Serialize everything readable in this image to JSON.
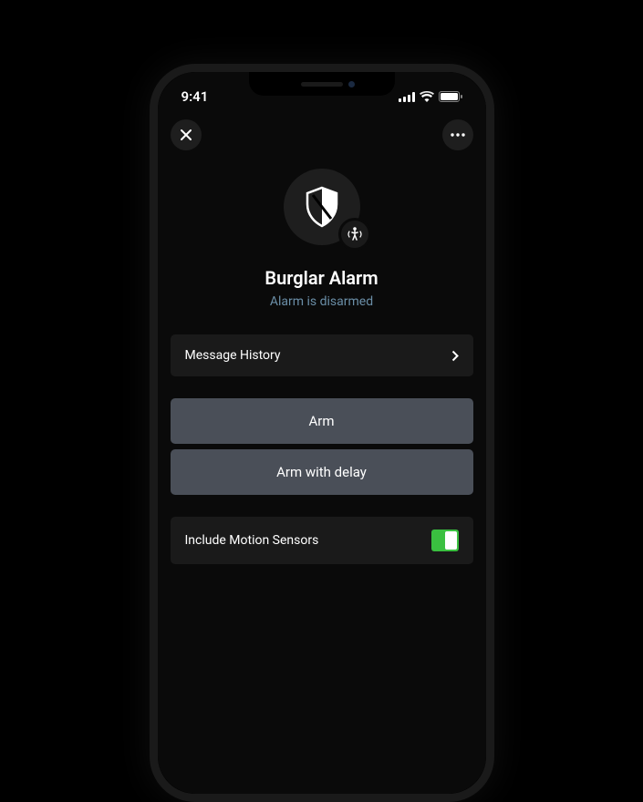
{
  "status_bar": {
    "time": "9:41"
  },
  "header": {},
  "alarm": {
    "title": "Burglar Alarm",
    "status": "Alarm is disarmed"
  },
  "rows": {
    "message_history": "Message History"
  },
  "actions": {
    "arm": "Arm",
    "arm_delay": "Arm with delay"
  },
  "toggle": {
    "label": "Include Motion Sensors",
    "value": true
  }
}
